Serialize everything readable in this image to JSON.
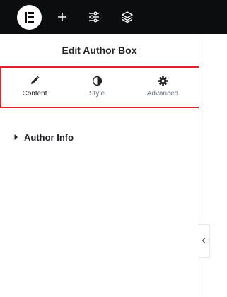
{
  "toolbar": {
    "logo_icon": "elementor-logo-icon",
    "add_icon": "plus-icon",
    "settings_icon": "sliders-icon",
    "structure_icon": "layers-icon"
  },
  "panel": {
    "title": "Edit Author Box",
    "tabs": [
      {
        "label": "Content",
        "icon": "pencil-icon",
        "active": true
      },
      {
        "label": "Style",
        "icon": "half-circle-icon",
        "active": false
      },
      {
        "label": "Advanced",
        "icon": "gear-icon",
        "active": false
      }
    ],
    "sections": [
      {
        "label": "Author Info",
        "icon": "caret-right-icon"
      }
    ]
  },
  "colors": {
    "topbar": "#0c0d0e",
    "highlight_border": "#e0222d",
    "muted_text": "#69727d"
  }
}
